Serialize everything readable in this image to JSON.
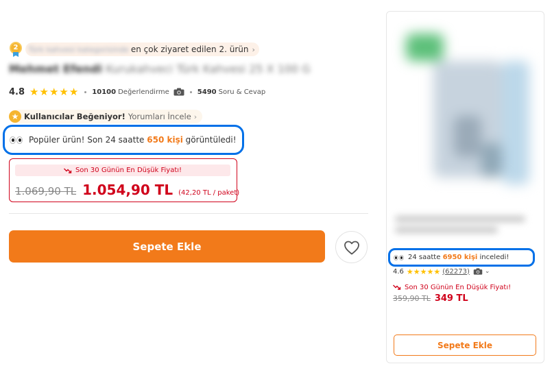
{
  "product": {
    "rank": {
      "medal_number": "2",
      "category_blurred": "Türk kahvesi kategorisinde",
      "text": "en çok ziyaret edilen 2. ürün",
      "chevron": "›"
    },
    "title": {
      "brand": "Mehmet Efendi",
      "name": "Kurukahveci Türk Kahvesi 25 X 100 G"
    },
    "rating": {
      "score": "4.8",
      "stars": 5,
      "review_count": "10100",
      "review_label": "Değerlendirme",
      "qa_count": "5490",
      "qa_label": "Soru & Cevap"
    },
    "liked": {
      "strong": "Kullanıcılar Beğeniyor!",
      "link": "Yorumları İncele",
      "chevron": "›"
    },
    "popular": {
      "prefix": "Popüler ürün! Son 24 saatte",
      "count": "650 kişi",
      "suffix": "görüntüledi!"
    },
    "price": {
      "lowest_banner": "Son 30 Günün En Düşük Fiyatı!",
      "old": "1.069,90 TL",
      "new": "1.054,90 TL",
      "unit": "(42,20 TL / paket)"
    },
    "add_to_cart_label": "Sepete Ekle"
  },
  "recommendation": {
    "views": {
      "prefix": "24 saatte",
      "count": "6950 kişi",
      "suffix": "inceledi!"
    },
    "rating": {
      "score": "4.6",
      "stars": 5,
      "count": "(62273)",
      "chevron": "⌄"
    },
    "lowest_label": "Son 30 Günün En Düşük Fiyatı!",
    "old_price": "359,90 TL",
    "new_price": "349 TL",
    "add_to_cart_label": "Sepete Ekle"
  },
  "colors": {
    "accent_orange": "#f27a1a",
    "price_red": "#d0021b",
    "highlight_blue": "#0070e8",
    "star_yellow": "#ffc000"
  },
  "icons": {
    "medal": "medal-icon",
    "star": "star-icon",
    "camera": "camera-icon",
    "eyes": "eyes-icon",
    "trend_down": "trend-down-icon",
    "heart": "heart-icon"
  }
}
